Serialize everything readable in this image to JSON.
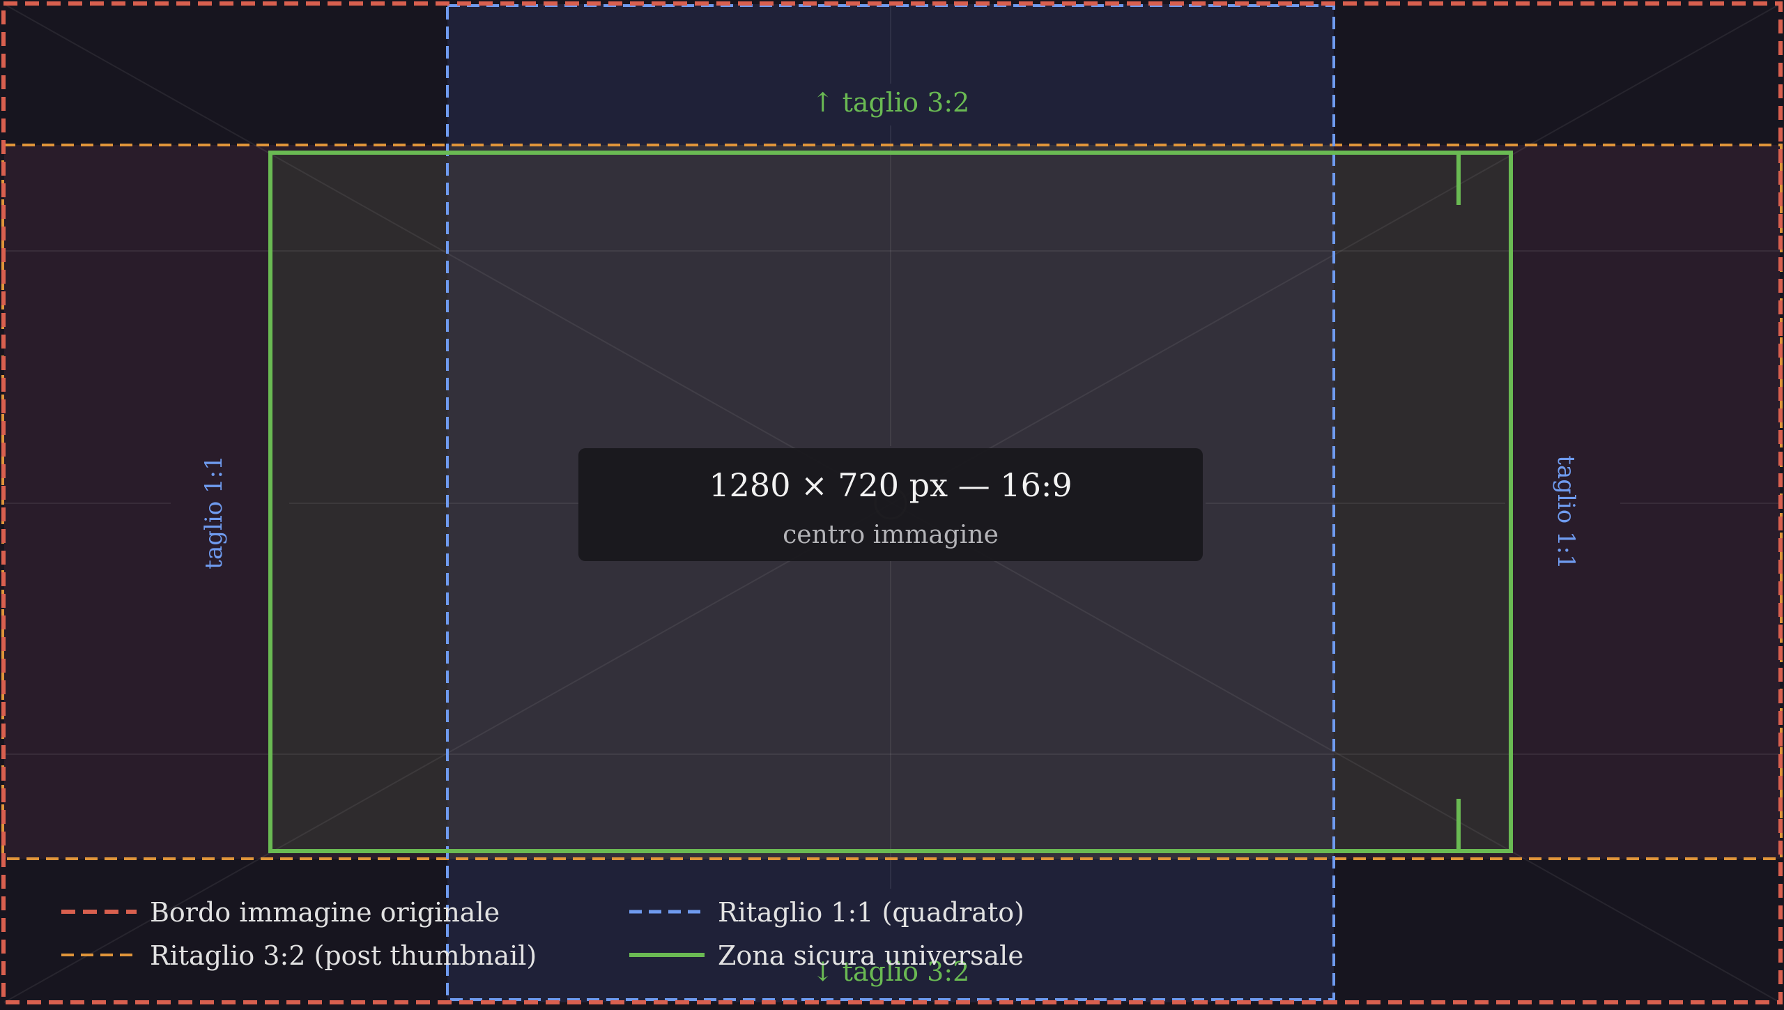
{
  "labels": {
    "crop_32_top": "↑ taglio 3:2",
    "crop_32_bottom": "↓ taglio 3:2",
    "crop_11_left": "taglio 1:1",
    "crop_11_right": "taglio 1:1"
  },
  "center_box": {
    "title": "1280 × 720 px — 16:9",
    "subtitle": "centro immagine"
  },
  "legend": [
    {
      "name": "legend-original-border",
      "label": "Bordo immagine originale",
      "color": "#d9604f",
      "style": "dashed"
    },
    {
      "name": "legend-crop-32",
      "label": "Ritaglio 3:2 (post thumbnail)",
      "color": "#e0953a",
      "style": "dashed"
    },
    {
      "name": "legend-crop-11",
      "label": "Ritaglio 1:1 (quadrato)",
      "color": "#6f9bef",
      "style": "dashed"
    },
    {
      "name": "legend-safe-zone",
      "label": "Zona sicura universale",
      "color": "#6aba53",
      "style": "solid"
    }
  ],
  "colors": {
    "background": "#17151f",
    "band_32": "#291c2a",
    "band_11": "#1f2138",
    "overlap": "#33303a",
    "safe_side": "#2e2b2d",
    "original": "#d9604f",
    "crop_32": "#e0953a",
    "crop_11": "#6f9bef",
    "safe": "#6aba53"
  }
}
